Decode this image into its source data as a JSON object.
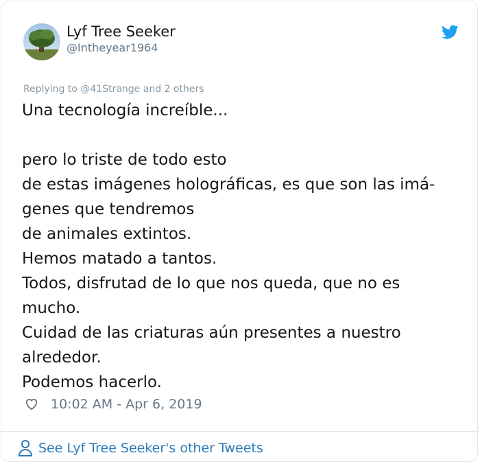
{
  "author": {
    "display_name": "Lyf Tree Seeker",
    "handle": "@Intheyear1964",
    "avatar_icon": "tree-avatar"
  },
  "brand": {
    "icon": "twitter-bird-icon",
    "color": "#1da1f2"
  },
  "tweet": {
    "replying_prefix": "Replying to",
    "replying_to": "@41Strange",
    "replying_suffix": "and 2 others",
    "lines": [
      "Una tecnología increíble...",
      "",
      "pero lo triste de todo esto",
      "de estas imágenes holográficas, es que son las imá-",
      "genes que tendremos",
      "de animales extintos.",
      "Hemos matado a tantos.",
      "Todos, disfrutad de lo que nos queda, que no es",
      "mucho.",
      "Cuidad de las criaturas aún presentes a nuestro",
      "alrededor.",
      "Podemos hacerlo."
    ],
    "timestamp": "10:02 AM - Apr 6, 2019"
  },
  "footer": {
    "link_text": "See Lyf Tree Seeker's other Tweets",
    "icon": "person-icon"
  },
  "colors": {
    "link": "#2b7bb9",
    "secondary_text": "#657786",
    "border": "#e1e8ed"
  }
}
